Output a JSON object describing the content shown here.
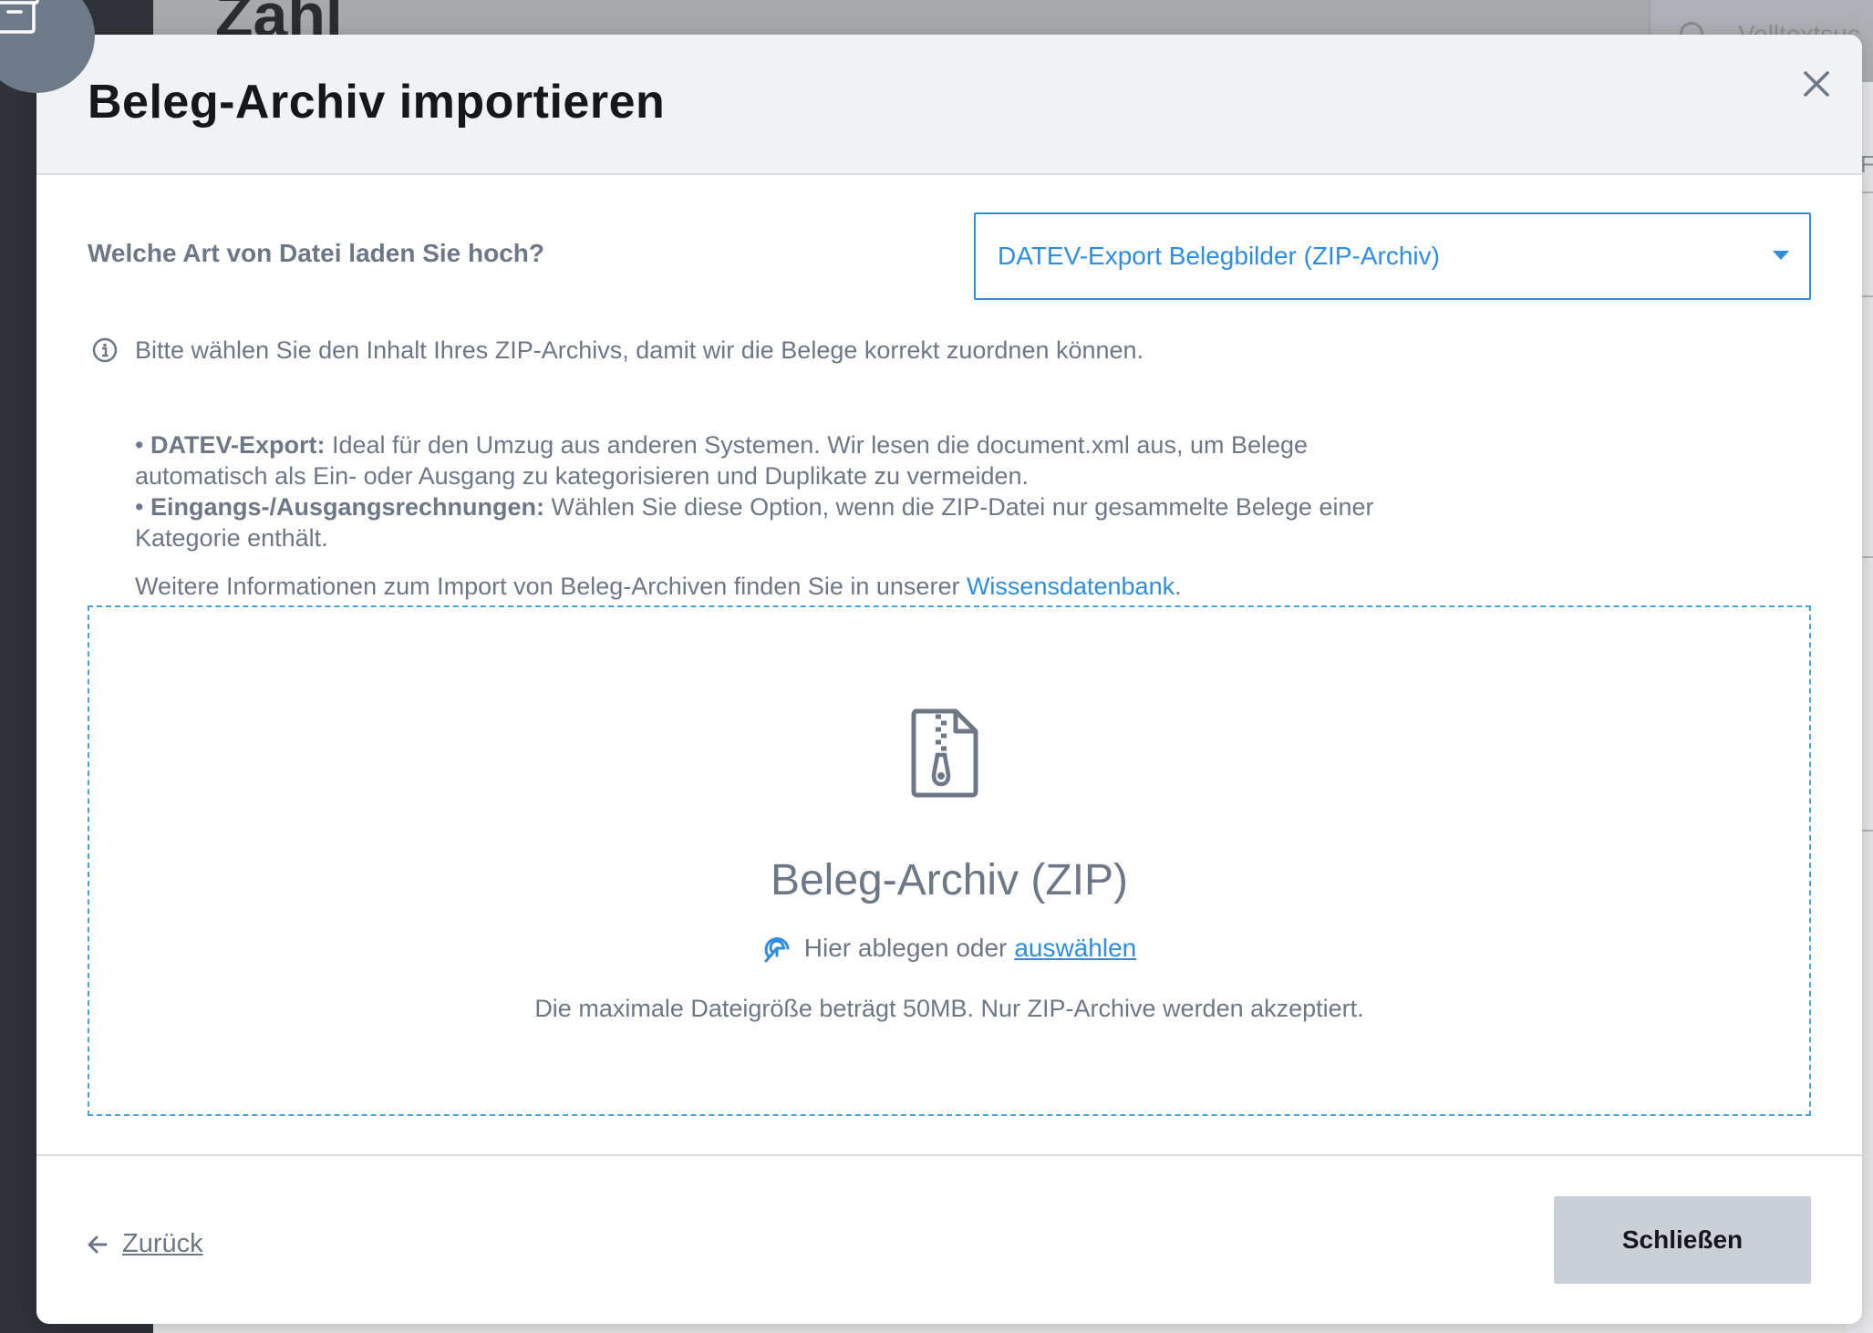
{
  "background": {
    "title": "Zahl",
    "search_placeholder": "Volltextsuc",
    "side_letter": "F"
  },
  "modal": {
    "title": "Beleg-Archiv importieren",
    "filetype_label": "Welche Art von Datei laden Sie hoch?",
    "filetype_selected": "DATEV-Export Belegbilder (ZIP-Archiv)",
    "info_intro": "Bitte wählen Sie den Inhalt Ihres ZIP-Archivs, damit wir die Belege korrekt zuordnen können.",
    "bullets": {
      "datev_term": "DATEV-Export:",
      "datev_text_1": " Ideal für den Umzug aus anderen Systemen. Wir lesen die document.xml aus, um Belege",
      "datev_text_2": "automatisch als Ein- oder Ausgang zu kategorisieren und Duplikate zu vermeiden.",
      "inout_term": "Eingangs-/Ausgangsrechnungen:",
      "inout_text_1": " Wählen Sie diese Option, wenn die ZIP-Datei nur gesammelte Belege einer",
      "inout_text_2": "Kategorie enthält."
    },
    "more_info_text": "Weitere Informationen zum Import von Beleg-Archiven finden Sie in unserer ",
    "more_info_link": "Wissensdatenbank",
    "more_info_end": "."
  },
  "dropzone": {
    "title": "Beleg-Archiv (ZIP)",
    "drop_text": "Hier ablegen oder",
    "select_link": "auswählen",
    "hint": "Die maximale Dateigröße beträgt 50MB. Nur ZIP-Archive werden akzeptiert."
  },
  "footer": {
    "back_label": "Zurück",
    "close_label": "Schließen"
  },
  "colors": {
    "accent": "#2f8de0",
    "text_muted": "#6e7786",
    "button_bg": "#cbcfd7"
  },
  "icons": [
    "archive-icon",
    "close-icon",
    "chevron-down-icon",
    "info-icon",
    "zip-file-icon",
    "drop-target-icon",
    "arrow-left-icon",
    "search-icon"
  ]
}
